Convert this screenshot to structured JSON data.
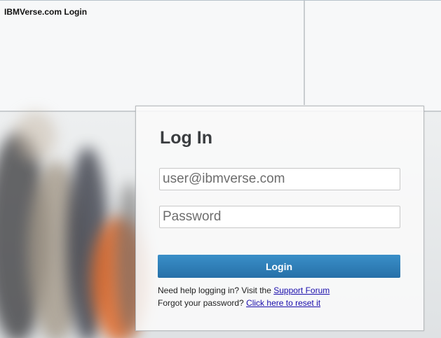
{
  "page": {
    "title": "IBMVerse.com Login"
  },
  "login_panel": {
    "heading": "Log In",
    "username_placeholder": "user@ibmverse.com",
    "password_placeholder": "Password",
    "login_label": "Login",
    "help_text": "Need help logging in? Visit the ",
    "support_link": "Support Forum",
    "forgot_text": "Forgot your password? ",
    "reset_link": "Click here to reset it"
  },
  "colors": {
    "button": "#2a78b0",
    "link": "#1a0dab",
    "heading": "#3a3d40"
  }
}
